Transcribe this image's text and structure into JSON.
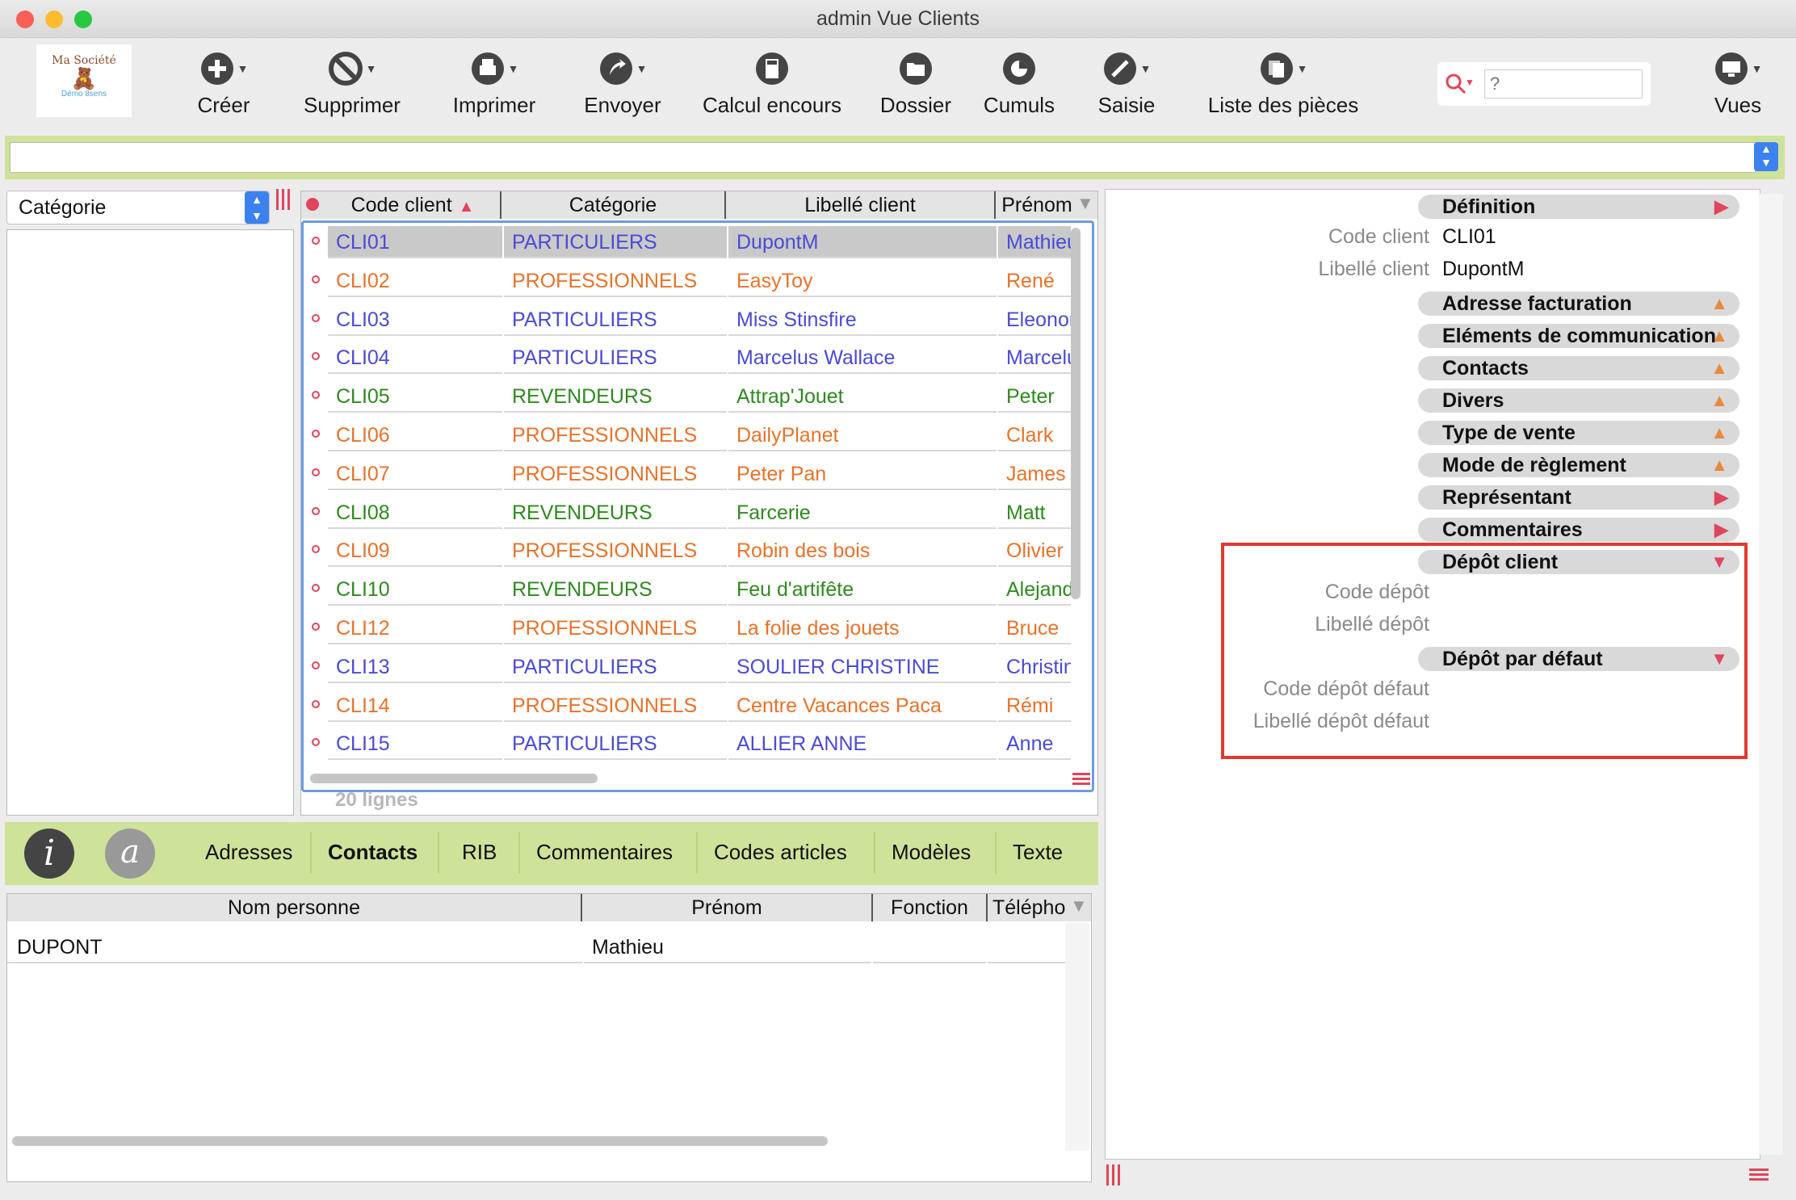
{
  "window": {
    "title": "admin Vue Clients"
  },
  "logo": {
    "line1": "Ma Société",
    "line2": "Démo 8sens"
  },
  "toolbar": {
    "creer": "Créer",
    "supprimer": "Supprimer",
    "imprimer": "Imprimer",
    "envoyer": "Envoyer",
    "calcul_encours": "Calcul encours",
    "dossier": "Dossier",
    "cumuls": "Cumuls",
    "saisie": "Saisie",
    "liste_pieces": "Liste des pièces",
    "vues": "Vues",
    "search_placeholder": "?"
  },
  "filter": {
    "category_label": "Catégorie"
  },
  "clients": {
    "columns": [
      "Code client",
      "Catégorie",
      "Libellé client",
      "Prénom"
    ],
    "rows": [
      {
        "code": "CLI01",
        "cat": "PARTICULIERS",
        "lib": "DupontM",
        "prenom": "Mathieu",
        "color": "#4a4ad6"
      },
      {
        "code": "CLI02",
        "cat": "PROFESSIONNELS",
        "lib": "EasyToy",
        "prenom": "René",
        "color": "#e8722a"
      },
      {
        "code": "CLI03",
        "cat": "PARTICULIERS",
        "lib": "Miss Stinsfire",
        "prenom": "Eleonora",
        "color": "#4a4ad6"
      },
      {
        "code": "CLI04",
        "cat": "PARTICULIERS",
        "lib": "Marcelus Wallace",
        "prenom": "Marcelus",
        "color": "#4a4ad6"
      },
      {
        "code": "CLI05",
        "cat": "REVENDEURS",
        "lib": "Attrap'Jouet",
        "prenom": "Peter",
        "color": "#2e8a1e"
      },
      {
        "code": "CLI06",
        "cat": "PROFESSIONNELS",
        "lib": "DailyPlanet",
        "prenom": "Clark",
        "color": "#e8722a"
      },
      {
        "code": "CLI07",
        "cat": "PROFESSIONNELS",
        "lib": "Peter Pan",
        "prenom": "James",
        "color": "#e8722a"
      },
      {
        "code": "CLI08",
        "cat": "REVENDEURS",
        "lib": "Farcerie",
        "prenom": "Matt",
        "color": "#2e8a1e"
      },
      {
        "code": "CLI09",
        "cat": "PROFESSIONNELS",
        "lib": "Robin des bois",
        "prenom": "Olivier",
        "color": "#e8722a"
      },
      {
        "code": "CLI10",
        "cat": "REVENDEURS",
        "lib": "Feu d'artifête",
        "prenom": "Alejandro",
        "color": "#2e8a1e"
      },
      {
        "code": "CLI12",
        "cat": "PROFESSIONNELS",
        "lib": "La folie des jouets",
        "prenom": "Bruce",
        "color": "#e8722a"
      },
      {
        "code": "CLI13",
        "cat": "PARTICULIERS",
        "lib": "SOULIER CHRISTINE",
        "prenom": "Christine",
        "color": "#4a4ad6"
      },
      {
        "code": "CLI14",
        "cat": "PROFESSIONNELS",
        "lib": "Centre Vacances Paca",
        "prenom": "Rémi",
        "color": "#e8722a"
      },
      {
        "code": "CLI15",
        "cat": "PARTICULIERS",
        "lib": "ALLIER ANNE",
        "prenom": "Anne",
        "color": "#4a4ad6"
      }
    ],
    "count": "20 lignes"
  },
  "tabs": [
    "Adresses",
    "Contacts",
    "RIB",
    "Commentaires",
    "Codes articles",
    "Modèles",
    "Texte"
  ],
  "tab_icons": {
    "info": "i",
    "at": "a"
  },
  "contacts": {
    "columns": [
      "Nom personne",
      "Prénom",
      "Fonction",
      "Télépho"
    ],
    "rows": [
      {
        "nom": "DUPONT",
        "prenom": "Mathieu",
        "fonction": "",
        "tel": ""
      }
    ]
  },
  "detail": {
    "definition": "Définition",
    "code_client_label": "Code client",
    "code_client_value": "CLI01",
    "libelle_client_label": "Libellé client",
    "libelle_client_value": "DupontM",
    "adresse_facturation": "Adresse facturation",
    "elements_communication": "Eléments de communication",
    "contacts": "Contacts",
    "divers": "Divers",
    "type_vente": "Type de vente",
    "mode_reglement": "Mode de règlement",
    "representant": "Représentant",
    "commentaires": "Commentaires",
    "depot_client": "Dépôt client",
    "code_depot_label": "Code dépôt",
    "libelle_depot_label": "Libellé dépôt",
    "depot_defaut": "Dépôt par défaut",
    "code_depot_defaut_label": "Code dépôt défaut",
    "libelle_depot_defaut_label": "Libellé dépôt défaut"
  },
  "colors": {
    "accent_red": "#e0455c",
    "highlight_box": "#e03a2e",
    "green_bar": "#cfe29a",
    "arrow_orange": "#e88a3a"
  }
}
